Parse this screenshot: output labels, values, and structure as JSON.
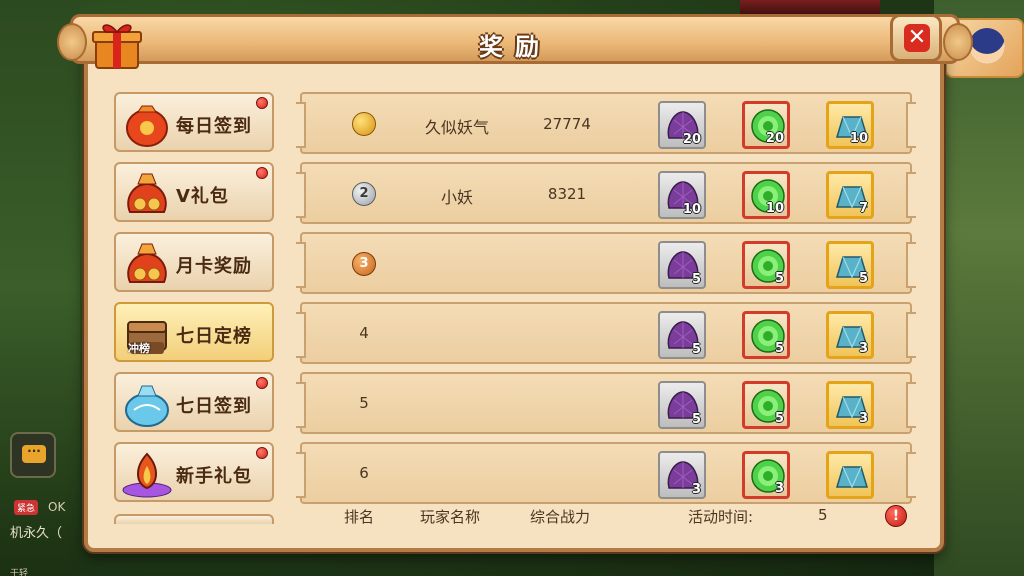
{
  "window": {
    "title": "奖励"
  },
  "close_label": "✕",
  "sidebar": {
    "items": [
      {
        "label": "每日签到",
        "icon": "lantern-bag-icon",
        "badge": true,
        "active": false
      },
      {
        "label": "V礼包",
        "icon": "lucky-bag-icon",
        "badge": true,
        "active": false
      },
      {
        "label": "月卡奖励",
        "icon": "lucky-bag-icon",
        "badge": false,
        "active": false
      },
      {
        "label": "七日定榜",
        "icon": "rank-chest-icon",
        "badge": false,
        "active": true,
        "icon_text": "冲榜"
      },
      {
        "label": "七日签到",
        "icon": "crystal-bag-icon",
        "badge": true,
        "active": false
      },
      {
        "label": "新手礼包",
        "icon": "flame-gift-icon",
        "badge": true,
        "active": false
      }
    ]
  },
  "rows": [
    {
      "rank": "",
      "medal": "gold",
      "medal_text": "",
      "name": "久似妖气",
      "power": "27774",
      "rewards": [
        "20",
        "20",
        "10"
      ]
    },
    {
      "rank": "",
      "medal": "silver",
      "medal_text": "2",
      "name": "小妖",
      "power": "8321",
      "rewards": [
        "10",
        "10",
        "7"
      ]
    },
    {
      "rank": "",
      "medal": "bronze",
      "medal_text": "3",
      "name": "",
      "power": "",
      "rewards": [
        "5",
        "5",
        "5"
      ]
    },
    {
      "rank": "4",
      "medal": "",
      "medal_text": "",
      "name": "",
      "power": "",
      "rewards": [
        "5",
        "5",
        "3"
      ]
    },
    {
      "rank": "5",
      "medal": "",
      "medal_text": "",
      "name": "",
      "power": "",
      "rewards": [
        "5",
        "5",
        "3"
      ]
    },
    {
      "rank": "6",
      "medal": "",
      "medal_text": "",
      "name": "",
      "power": "",
      "rewards": [
        "3",
        "3",
        ""
      ]
    }
  ],
  "reward_icons": [
    "purple-pouch-icon",
    "green-jade-icon",
    "blue-crystal-icon"
  ],
  "footer": {
    "rank_label": "排名",
    "name_label": "玩家名称",
    "power_label": "综合战力",
    "time_label": "活动时间:",
    "time_value": "5",
    "alert": "!"
  },
  "background": {
    "chat_icon": "···",
    "side_tag": "紧急",
    "side_ok": "OK",
    "side_text": "机永久（",
    "bottom_text": "于轻"
  },
  "colors": {
    "panel": "#f6e2c0",
    "border": "#b47b45",
    "text": "#4a3620",
    "badge": "#d8231a"
  }
}
